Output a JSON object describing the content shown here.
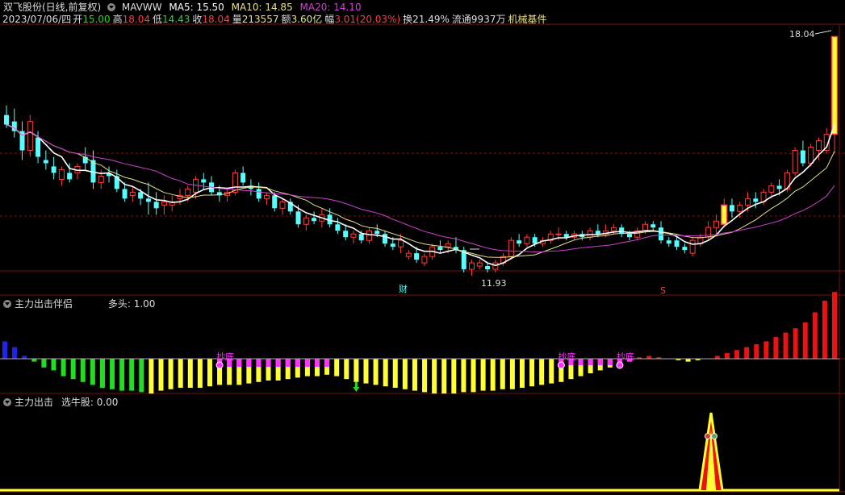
{
  "header": {
    "title": "双飞股份(日线,前复权)",
    "date": "2023/07/06/四",
    "open_label": "开",
    "open_value": "15.00",
    "high_label": "高",
    "high_value": "18.04",
    "low_label": "低",
    "low_value": "14.43",
    "close_label": "收",
    "close_value": "18.04",
    "vol_label": "量",
    "vol_value": "213557",
    "amt_label": "额",
    "amt_value": "3.60亿",
    "chg_label": "幅",
    "chg_value": "3.01(20.03%)",
    "turnover": "换21.49%",
    "float": "流通9937万",
    "industry": "机械基件",
    "ma_name": "MAVWW",
    "ma5": "MA5: 15.50",
    "ma10": "MA10: 14.85",
    "ma20": "MA20: 14.10"
  },
  "panel2": {
    "name": "主力出击伴侣",
    "value_label": "多头: 1.00",
    "marker_text": "抄底"
  },
  "panel3": {
    "name": "主力出击",
    "value_label": "选牛股: 0.00"
  },
  "colors": {
    "up": "#ff3c3c",
    "down": "#54ffff",
    "ma5": "#ffffff",
    "ma10": "#e8e08c",
    "ma20": "#d040d0",
    "grid": "#7a1010",
    "yellow": "#ffff33",
    "green": "#22dd22",
    "magenta": "#ff33ff",
    "blue": "#2222ee",
    "red": "#ee1111"
  },
  "chart_data": [
    {
      "type": "candlestick",
      "annotations": {
        "high_label": "18.04",
        "low_label": "11.93",
        "finance_marker": "财",
        "s_marker": "S"
      },
      "candles": [
        [
          15.6,
          15.9,
          15.2,
          15.3
        ],
        [
          15.4,
          15.8,
          14.9,
          15.1
        ],
        [
          15.1,
          15.4,
          14.2,
          14.5
        ],
        [
          14.5,
          15.6,
          14.3,
          15.4
        ],
        [
          14.9,
          15.1,
          14.1,
          14.3
        ],
        [
          14.2,
          14.5,
          13.9,
          14.1
        ],
        [
          14.0,
          14.3,
          13.6,
          13.8
        ],
        [
          13.6,
          14.0,
          13.4,
          13.9
        ],
        [
          13.8,
          14.1,
          13.5,
          13.6
        ],
        [
          13.8,
          14.1,
          13.6,
          14.0
        ],
        [
          14.3,
          14.6,
          13.9,
          14.1
        ],
        [
          14.2,
          14.5,
          13.3,
          13.5
        ],
        [
          13.5,
          13.9,
          13.3,
          13.7
        ],
        [
          13.8,
          14.0,
          13.5,
          13.7
        ],
        [
          13.7,
          13.9,
          13.2,
          13.3
        ],
        [
          13.3,
          13.5,
          12.9,
          13.0
        ],
        [
          13.1,
          13.4,
          12.9,
          13.2
        ],
        [
          13.2,
          13.3,
          12.8,
          13.0
        ],
        [
          13.0,
          13.5,
          12.5,
          12.9
        ],
        [
          12.9,
          13.2,
          12.5,
          12.7
        ],
        [
          12.8,
          13.1,
          12.5,
          12.9
        ],
        [
          12.8,
          13.1,
          12.6,
          12.9
        ],
        [
          13.0,
          13.3,
          12.8,
          13.1
        ],
        [
          13.1,
          13.4,
          12.9,
          13.3
        ],
        [
          13.2,
          13.7,
          13.0,
          13.6
        ],
        [
          13.6,
          13.8,
          13.3,
          13.5
        ],
        [
          13.5,
          13.7,
          13.1,
          13.2
        ],
        [
          13.2,
          13.4,
          12.9,
          13.1
        ],
        [
          13.1,
          13.3,
          12.9,
          13.2
        ],
        [
          13.2,
          13.9,
          13.1,
          13.8
        ],
        [
          13.8,
          14.0,
          13.4,
          13.5
        ],
        [
          13.4,
          13.6,
          13.1,
          13.3
        ],
        [
          13.3,
          13.5,
          12.9,
          13.0
        ],
        [
          13.0,
          13.2,
          12.8,
          13.1
        ],
        [
          13.1,
          13.2,
          12.6,
          12.7
        ],
        [
          12.7,
          13.0,
          12.5,
          12.9
        ],
        [
          12.9,
          13.0,
          12.5,
          12.6
        ],
        [
          12.6,
          12.8,
          12.1,
          12.2
        ],
        [
          12.2,
          12.5,
          12.0,
          12.4
        ],
        [
          12.4,
          12.6,
          12.2,
          12.3
        ],
        [
          12.3,
          12.7,
          12.1,
          12.5
        ],
        [
          12.5,
          12.7,
          12.1,
          12.2
        ],
        [
          12.2,
          12.4,
          11.9,
          12.0
        ],
        [
          12.0,
          12.2,
          11.7,
          11.8
        ],
        [
          11.8,
          12.0,
          11.6,
          11.9
        ],
        [
          11.9,
          12.0,
          11.6,
          11.7
        ],
        [
          11.7,
          12.1,
          11.6,
          12.0
        ],
        [
          12.0,
          12.2,
          11.8,
          11.9
        ],
        [
          11.9,
          12.0,
          11.5,
          11.6
        ],
        [
          11.6,
          11.8,
          11.4,
          11.5
        ],
        [
          11.5,
          11.9,
          11.3,
          11.7
        ],
        [
          11.2,
          11.4,
          11.1,
          11.3
        ],
        [
          11.3,
          11.5,
          11.0,
          11.1
        ],
        [
          11.0,
          11.3,
          10.9,
          11.2
        ],
        [
          11.2,
          11.6,
          11.1,
          11.5
        ],
        [
          11.5,
          11.7,
          11.3,
          11.4
        ],
        [
          11.5,
          11.7,
          11.3,
          11.6
        ],
        [
          11.5,
          11.8,
          11.3,
          11.4
        ],
        [
          11.4,
          11.5,
          10.7,
          10.8
        ],
        [
          10.8,
          11.1,
          10.6,
          11.0
        ],
        [
          10.9,
          11.1,
          10.8,
          11.0
        ],
        [
          10.9,
          11.0,
          10.7,
          10.8
        ],
        [
          10.8,
          11.1,
          10.7,
          11.0
        ],
        [
          11.0,
          11.3,
          10.9,
          11.2
        ],
        [
          11.2,
          11.8,
          11.1,
          11.7
        ],
        [
          11.7,
          11.9,
          11.5,
          11.6
        ],
        [
          11.6,
          11.9,
          11.5,
          11.8
        ],
        [
          11.8,
          11.9,
          11.5,
          11.6
        ],
        [
          11.6,
          11.8,
          11.5,
          11.7
        ],
        [
          11.7,
          12.0,
          11.6,
          11.9
        ],
        [
          11.9,
          12.1,
          11.7,
          11.9
        ],
        [
          11.9,
          12.0,
          11.7,
          11.8
        ],
        [
          11.8,
          12.0,
          11.7,
          11.9
        ],
        [
          11.9,
          12.0,
          11.7,
          11.8
        ],
        [
          11.8,
          12.1,
          11.7,
          12.0
        ],
        [
          12.0,
          12.2,
          11.8,
          11.9
        ],
        [
          11.9,
          12.2,
          11.8,
          12.0
        ],
        [
          12.0,
          12.2,
          11.9,
          12.1
        ],
        [
          12.1,
          12.2,
          11.8,
          11.9
        ],
        [
          11.9,
          12.0,
          11.7,
          11.8
        ],
        [
          11.8,
          12.1,
          11.7,
          12.0
        ],
        [
          12.0,
          12.3,
          11.9,
          12.2
        ],
        [
          12.2,
          12.3,
          12.0,
          12.1
        ],
        [
          12.1,
          12.3,
          11.6,
          11.7
        ],
        [
          11.7,
          11.8,
          11.5,
          11.6
        ],
        [
          11.7,
          11.8,
          11.4,
          11.5
        ],
        [
          11.5,
          11.6,
          11.3,
          11.4
        ],
        [
          11.3,
          11.8,
          11.2,
          11.7
        ],
        [
          11.6,
          11.9,
          11.5,
          11.8
        ],
        [
          11.8,
          12.3,
          11.7,
          12.1
        ],
        [
          12.1,
          12.5,
          11.9,
          12.3
        ],
        [
          12.2,
          13.0,
          12.1,
          12.8
        ],
        [
          12.8,
          13.0,
          12.4,
          12.6
        ],
        [
          12.6,
          12.9,
          12.4,
          12.8
        ],
        [
          12.8,
          13.2,
          12.6,
          13.0
        ],
        [
          13.0,
          13.2,
          12.7,
          12.9
        ],
        [
          12.9,
          13.3,
          12.8,
          13.2
        ],
        [
          13.2,
          13.5,
          13.0,
          13.4
        ],
        [
          13.4,
          13.6,
          13.1,
          13.3
        ],
        [
          13.3,
          13.9,
          13.2,
          13.8
        ],
        [
          13.8,
          14.6,
          13.7,
          14.5
        ],
        [
          14.5,
          14.8,
          14.0,
          14.1
        ],
        [
          14.1,
          14.7,
          14.0,
          14.6
        ],
        [
          14.5,
          14.9,
          14.2,
          14.8
        ],
        [
          14.5,
          15.2,
          14.4,
          15.0
        ],
        [
          15.0,
          18.04,
          14.43,
          18.04
        ]
      ]
    },
    {
      "type": "bar",
      "series": [
        {
          "values": [
            0.6,
            0.4,
            0.1,
            -0.1,
            -0.3,
            -0.4,
            -0.6,
            -0.7,
            -0.8,
            -0.9,
            -1.0,
            -1.05,
            -1.1,
            -1.1,
            -1.15,
            -1.2,
            -1.1,
            -1.05,
            -1.0,
            -1.0,
            -1.0,
            -0.95,
            -0.9,
            -0.9,
            -0.9,
            -0.85,
            -0.8,
            -0.75,
            -0.75,
            -0.7,
            -0.65,
            -0.6,
            -0.6,
            -0.55,
            -0.6,
            -0.7,
            -0.8,
            -0.85,
            -0.9,
            -0.95,
            -1.0,
            -1.05,
            -1.1,
            -1.15,
            -1.2,
            -1.2,
            -1.2,
            -1.15,
            -1.15,
            -1.1,
            -1.1,
            -1.05,
            -1.05,
            -1.0,
            -0.95,
            -0.9,
            -0.85,
            -0.8,
            -0.7,
            -0.6,
            -0.5,
            -0.4,
            -0.3,
            -0.2,
            -0.1,
            0.05,
            0.1,
            0.05,
            0.0,
            -0.05,
            -0.1,
            -0.05,
            0.0,
            0.1,
            0.2,
            0.3,
            0.4,
            0.5,
            0.6,
            0.75,
            0.9,
            1.05,
            1.25,
            1.6,
            2.0,
            2.3
          ]
        }
      ],
      "markers": {
        "buy_arrows_at": [
          36,
          91
        ],
        "sell_arrows_at": [
          93
        ],
        "label_at": [
          22,
          57,
          63
        ]
      }
    },
    {
      "type": "line",
      "series": [
        {
          "values": [
            0,
            0,
            0,
            0,
            0,
            0,
            0,
            0,
            0,
            0,
            0,
            0,
            0,
            1,
            0,
            0
          ]
        }
      ]
    }
  ]
}
